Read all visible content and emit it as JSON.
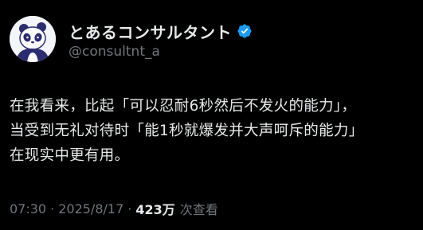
{
  "author": {
    "display_name": "とあるコンサルタント",
    "handle": "@consultnt_a",
    "verified": true,
    "avatar_icon": "panda-avatar-icon",
    "verified_icon": "verified-badge-icon"
  },
  "post": {
    "lines": [
      "在我看来，比起「可以忍耐6秒然后不发火的能力」，",
      "当受到无礼对待时「能1秒就爆发并大声呵斥的能力」",
      "在现实中更有用。"
    ]
  },
  "meta": {
    "time": "07:30",
    "separator": "·",
    "date": "2025/8/17",
    "views_count": "423万",
    "views_label": "次查看"
  },
  "colors": {
    "background": "#000000",
    "text": "#e7e9ea",
    "muted": "#71767b",
    "verified": "#1d9bf0"
  }
}
